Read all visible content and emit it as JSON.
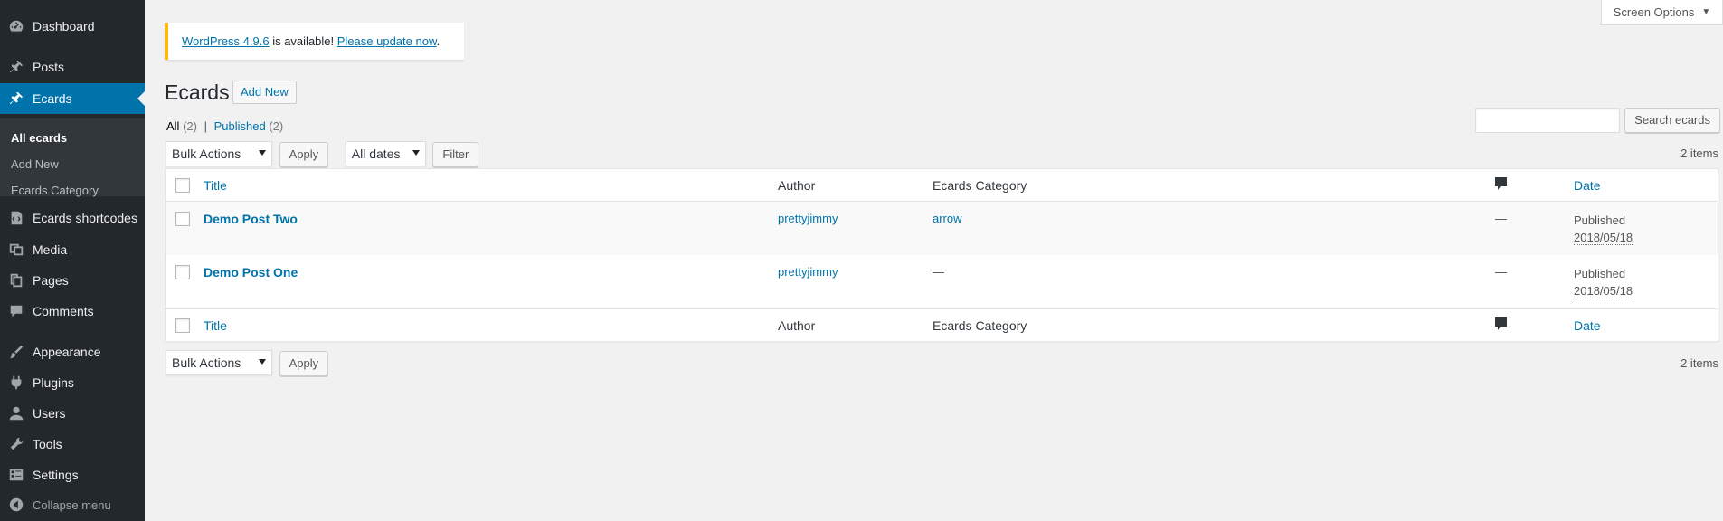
{
  "sidebar": {
    "items": [
      {
        "label": "Dashboard",
        "icon": "dashboard-icon"
      },
      {
        "label": "Posts",
        "icon": "pin-icon"
      },
      {
        "label": "Ecards",
        "icon": "pin-icon"
      },
      {
        "label": "Ecards shortcodes",
        "icon": "shortcode-icon"
      },
      {
        "label": "Media",
        "icon": "media-icon"
      },
      {
        "label": "Pages",
        "icon": "pages-icon"
      },
      {
        "label": "Comments",
        "icon": "comments-icon"
      },
      {
        "label": "Appearance",
        "icon": "brush-icon"
      },
      {
        "label": "Plugins",
        "icon": "plugin-icon"
      },
      {
        "label": "Users",
        "icon": "users-icon"
      },
      {
        "label": "Tools",
        "icon": "wrench-icon"
      },
      {
        "label": "Settings",
        "icon": "settings-icon"
      }
    ],
    "submenu": [
      "All ecards",
      "Add New",
      "Ecards Category"
    ],
    "collapse_label": "Collapse menu"
  },
  "screen_options": "Screen Options",
  "notice": {
    "link1": "WordPress 4.9.6",
    "text": " is available! ",
    "link2": "Please update now",
    "end": "."
  },
  "page": {
    "title": "Ecards",
    "add_new": "Add New"
  },
  "filters": {
    "all_label": "All",
    "all_count": "(2)",
    "sep": "|",
    "published_label": "Published",
    "published_count": "(2)"
  },
  "search": {
    "button": "Search ecards",
    "value": ""
  },
  "tablenav": {
    "bulk_actions": "Bulk Actions",
    "apply": "Apply",
    "all_dates": "All dates",
    "filter": "Filter",
    "items_count": "2 items"
  },
  "table": {
    "columns": {
      "title": "Title",
      "author": "Author",
      "category": "Ecards Category",
      "date": "Date"
    },
    "rows": [
      {
        "title": "Demo Post Two",
        "author": "prettyjimmy",
        "category": "arrow",
        "comments": "—",
        "status": "Published",
        "date": "2018/05/18"
      },
      {
        "title": "Demo Post One",
        "author": "prettyjimmy",
        "category": "—",
        "comments": "—",
        "status": "Published",
        "date": "2018/05/18"
      }
    ]
  },
  "colors": {
    "sidebar": "#23282d",
    "accent": "#0073aa",
    "notice_border": "#ffb900"
  }
}
